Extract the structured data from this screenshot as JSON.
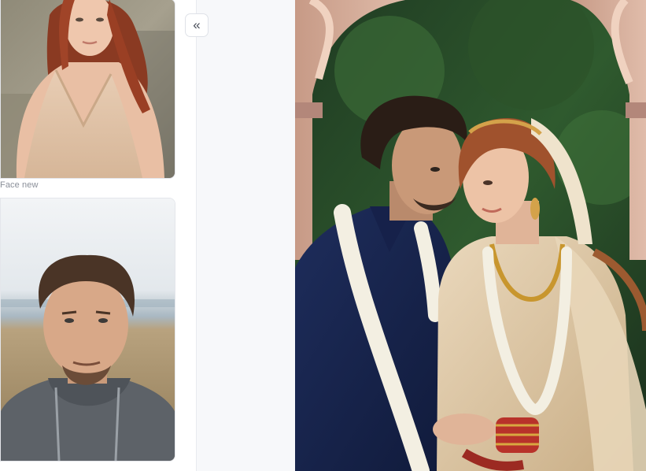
{
  "left_panel": {
    "face_label": "Face new"
  },
  "collapse_button": {
    "icon": "double-chevron-left-icon",
    "glyph": "«"
  },
  "colors": {
    "panel_bg": "#ffffff",
    "middle_bg": "#f7f8fa",
    "border": "#e4e6eb",
    "label_text": "#8a8f99"
  }
}
